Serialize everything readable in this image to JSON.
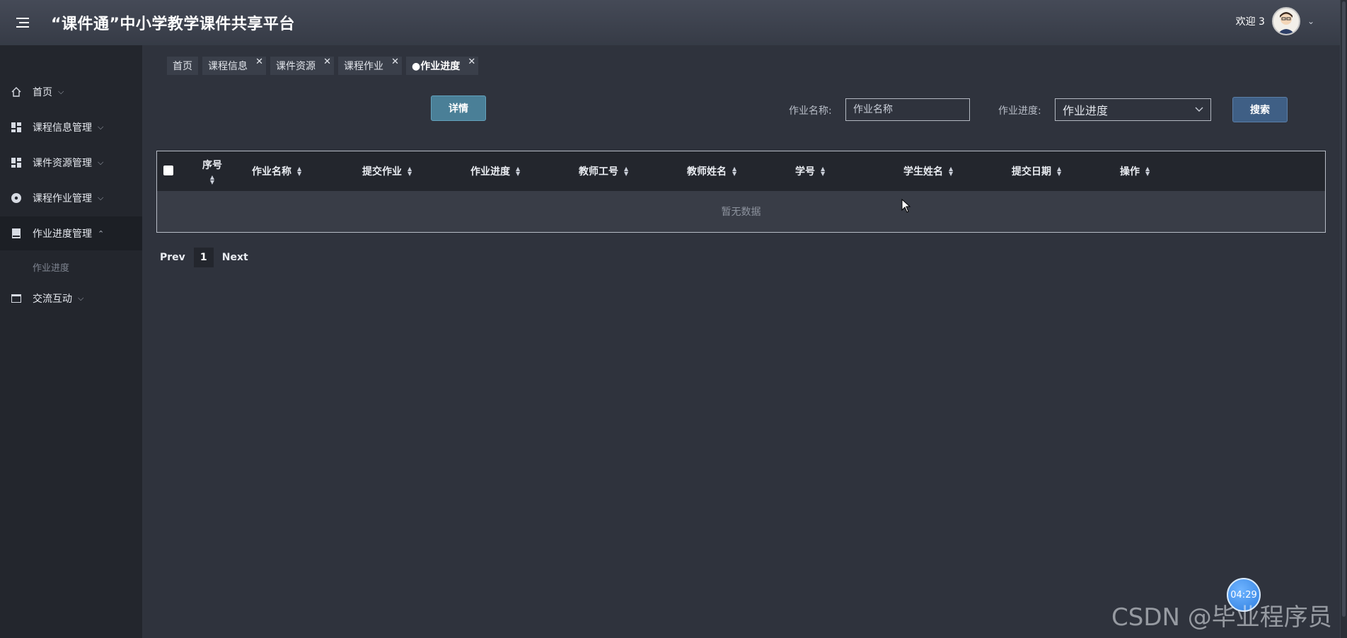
{
  "header": {
    "title": "“课件通”中小学教学课件共享平台",
    "welcome": "欢迎 3"
  },
  "sidebar": {
    "items": [
      {
        "label": "首页",
        "icon": "home-icon"
      },
      {
        "label": "课程信息管理",
        "icon": "dashboard-icon"
      },
      {
        "label": "课件资源管理",
        "icon": "dashboard-icon"
      },
      {
        "label": "课程作业管理",
        "icon": "disc-icon"
      },
      {
        "label": "作业进度管理",
        "icon": "book-icon"
      },
      {
        "label": "交流互动",
        "icon": "window-icon"
      }
    ],
    "sub_item": "作业进度"
  },
  "tabs": [
    {
      "label": "首页"
    },
    {
      "label": "课程信息"
    },
    {
      "label": "课件资源"
    },
    {
      "label": "课程作业"
    },
    {
      "label": "●作业进度"
    }
  ],
  "toolbar": {
    "detail_label": "详情",
    "name_label": "作业名称:",
    "name_placeholder": "作业名称",
    "progress_label": "作业进度:",
    "progress_value": "作业进度",
    "search_label": "搜索"
  },
  "table": {
    "columns": [
      "序号",
      "作业名称",
      "提交作业",
      "作业进度",
      "教师工号",
      "教师姓名",
      "学号",
      "学生姓名",
      "提交日期",
      "操作"
    ],
    "empty_text": "暂无数据"
  },
  "pagination": {
    "prev": "Prev",
    "page": "1",
    "next": "Next"
  },
  "overlay": {
    "timer": "04:29",
    "watermark": "CSDN @毕业程序员"
  }
}
